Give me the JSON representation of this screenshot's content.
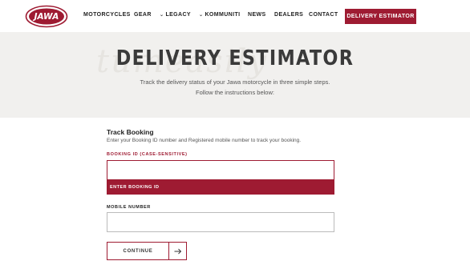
{
  "brand": {
    "logo_text": "JAWA",
    "accent": "#9e1b32"
  },
  "nav": {
    "items": [
      {
        "label": "MOTORCYCLES",
        "has_dropdown": false
      },
      {
        "label": "GEAR",
        "has_dropdown": false
      },
      {
        "label": "LEGACY",
        "has_dropdown": true
      },
      {
        "label": "KOMMUNITI",
        "has_dropdown": true
      },
      {
        "label": "NEWS",
        "has_dropdown": false
      },
      {
        "label": "DEALERS",
        "has_dropdown": false
      },
      {
        "label": "CONTACT",
        "has_dropdown": false
      }
    ],
    "cta_label": "DELIVERY ESTIMATOR",
    "chevron_icon": "chevron-down-icon"
  },
  "hero": {
    "title": "DELIVERY ESTIMATOR",
    "line1": "Track the delivery status of your Jawa motorcycle in three simple steps.",
    "line2": "Follow the instructions below:"
  },
  "form": {
    "title": "Track Booking",
    "description": "Enter your Booking ID number and Registered mobile number to track your booking.",
    "booking_label": "BOOKING ID (CASE-SENSITIVE)",
    "booking_value": "",
    "booking_error": "ENTER BOOKING ID",
    "mobile_label": "MOBILE NUMBER",
    "mobile_value": "",
    "continue_label": "CONTINUE",
    "arrow_icon": "arrow-right-icon"
  }
}
